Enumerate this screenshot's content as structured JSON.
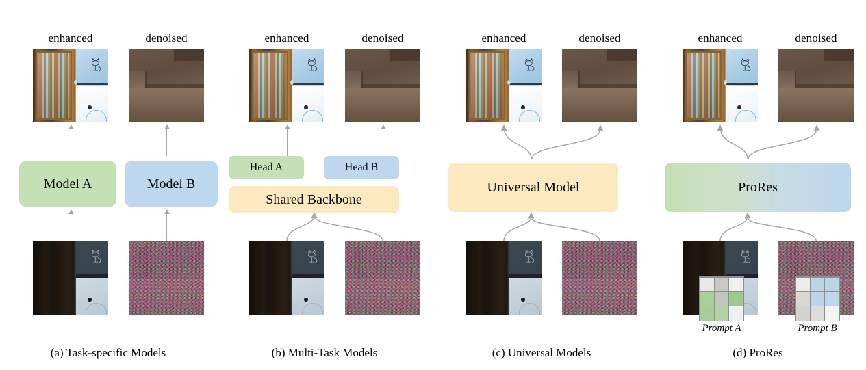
{
  "figure": {
    "columns": {
      "enhanced": "enhanced",
      "denoised": "denoised"
    },
    "prompt_a": "Prompt A",
    "prompt_b": "Prompt B"
  },
  "colors": {
    "green": "#c5e0b4",
    "blue": "#bdd7ee",
    "yellow": "#fce9c0",
    "arrow": "#a6a6a6",
    "gradient_start": "#c5e0b4",
    "gradient_end": "#bdd7ee"
  },
  "panels": [
    {
      "id": "a",
      "caption": "(a) Task-specific Models",
      "labels": {
        "enhanced": "enhanced",
        "denoised": "denoised"
      },
      "boxes": [
        {
          "label": "Model A",
          "color": "#c5e0b4"
        },
        {
          "label": "Model B",
          "color": "#bdd7ee"
        }
      ]
    },
    {
      "id": "b",
      "caption": "(b) Multi-Task Models",
      "labels": {
        "enhanced": "enhanced",
        "denoised": "denoised"
      },
      "boxes": [
        {
          "label": "Head A",
          "color": "#c5e0b4"
        },
        {
          "label": "Head B",
          "color": "#bdd7ee"
        },
        {
          "label": "Shared Backbone",
          "color": "#fce9c0"
        }
      ]
    },
    {
      "id": "c",
      "caption": "(c) Universal Models",
      "labels": {
        "enhanced": "enhanced",
        "denoised": "denoised"
      },
      "boxes": [
        {
          "label": "Universal Model",
          "color": "#fce9c0"
        }
      ]
    },
    {
      "id": "d",
      "caption": "(d) ProRes",
      "labels": {
        "enhanced": "enhanced",
        "denoised": "denoised"
      },
      "boxes": [
        {
          "label": "ProRes",
          "color": "#c5e0b4"
        }
      ],
      "prompts": [
        {
          "name": "Prompt A",
          "cells": [
            "#e9e9e7",
            "#c8c8c4",
            "#eef0ee",
            "#a9cf9a",
            "#c4c4bf",
            "#9ec98d",
            "#a8cc9b",
            "#b2d3a3",
            "#eef1ef"
          ]
        },
        {
          "name": "Prompt B",
          "cells": [
            "#ececeb",
            "#bcd4e8",
            "#bcd4e8",
            "#d8d7d2",
            "#bcd4e8",
            "#bed6e9",
            "#d4d3ce",
            "#dedcd6",
            "#f4f5f3"
          ]
        }
      ]
    }
  ]
}
